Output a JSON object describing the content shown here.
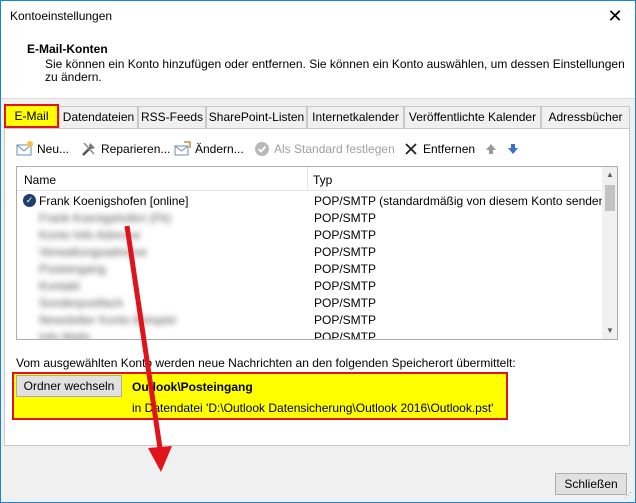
{
  "window": {
    "title": "Kontoeinstellungen",
    "close_glyph": "✕"
  },
  "header": {
    "title": "E-Mail-Konten",
    "description": "Sie können ein Konto hinzufügen oder entfernen. Sie können ein Konto auswählen, um dessen Einstellungen zu ändern."
  },
  "tabs": [
    {
      "label": "E-Mail",
      "active": true
    },
    {
      "label": "Datendateien"
    },
    {
      "label": "RSS-Feeds"
    },
    {
      "label": "SharePoint-Listen"
    },
    {
      "label": "Internetkalender"
    },
    {
      "label": "Veröffentlichte Kalender"
    },
    {
      "label": "Adressbücher"
    }
  ],
  "toolbar": {
    "new_label": "Neu...",
    "repair_label": "Reparieren...",
    "change_label": "Ändern...",
    "default_label": "Als Standard festlegen",
    "remove_label": "Entfernen",
    "up_icon": "arrow-up-icon",
    "down_icon": "arrow-down-icon"
  },
  "list": {
    "col_name": "Name",
    "col_type": "Typ",
    "rows": [
      {
        "name": "Frank Koenigshofen [online]",
        "type": "POP/SMTP (standardmäßig von diesem Konto senden)",
        "default": true,
        "blurred": false
      },
      {
        "name": "Frank Koenigshofen (Fk)",
        "type": "POP/SMTP",
        "blurred": true
      },
      {
        "name": "Konto Info Adresse",
        "type": "POP/SMTP",
        "blurred": true
      },
      {
        "name": "Verwaltungsadresse",
        "type": "POP/SMTP",
        "blurred": true
      },
      {
        "name": "Posteingang",
        "type": "POP/SMTP",
        "blurred": true
      },
      {
        "name": "Kontakt",
        "type": "POP/SMTP",
        "blurred": true
      },
      {
        "name": "Sonderpostfach",
        "type": "POP/SMTP",
        "blurred": true
      },
      {
        "name": "Newsletter Konto Beispiel",
        "type": "POP/SMTP",
        "blurred": true
      },
      {
        "name": "Info Mails",
        "type": "POP/SMTP",
        "blurred": true
      }
    ]
  },
  "delivery": {
    "info": "Vom ausgewählten Konto werden neue Nachrichten an den folgenden Speicherort übermittelt:",
    "button_label": "Ordner wechseln",
    "store_title": "Outlook\\Posteingang",
    "store_path": "in Datendatei 'D:\\Outlook Datensicherung\\Outlook 2016\\Outlook.pst'"
  },
  "footer": {
    "close_label": "Schließen"
  },
  "colors": {
    "highlight": "#ffff00",
    "annotation_red": "#e0131b"
  }
}
